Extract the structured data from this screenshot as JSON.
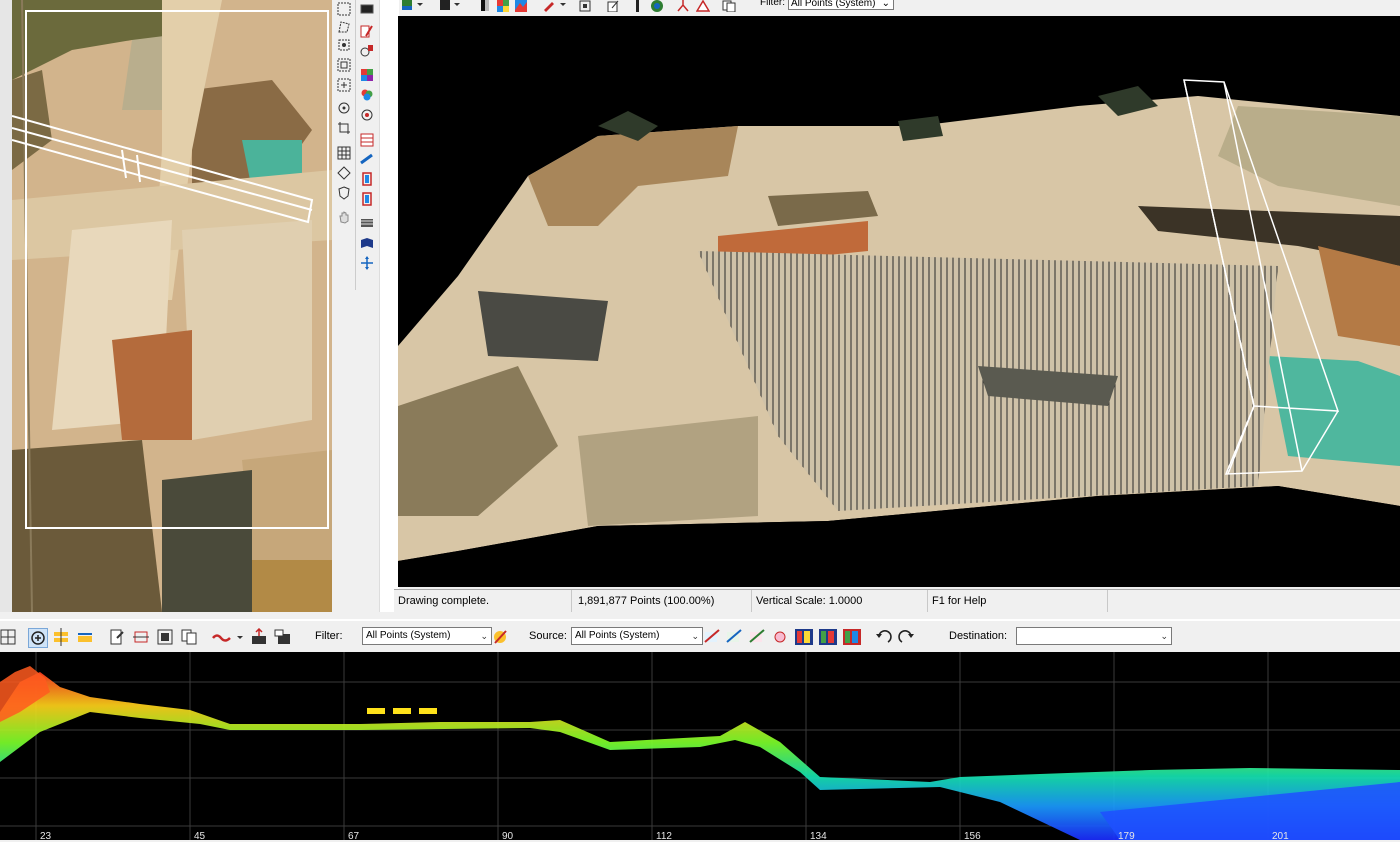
{
  "top_toolbar": {
    "filter_label": "Filter:",
    "filter_value": "All Points (System)"
  },
  "status": {
    "message": "Drawing complete.",
    "points": "1,891,877 Points (100.00%)",
    "vertical_scale": "Vertical Scale: 1.0000",
    "help": "F1 for Help"
  },
  "profile_toolbar": {
    "filter_label": "Filter:",
    "filter_value": "All Points (System)",
    "source_label": "Source:",
    "source_value": "All Points (System)",
    "destination_label": "Destination:",
    "destination_value": ""
  },
  "profile_axis": {
    "ticks": [
      "23",
      "45",
      "67",
      "90",
      "112",
      "134",
      "156",
      "179",
      "201"
    ]
  },
  "colors": {
    "toolbar_bg": "#f0f0f0",
    "view_bg": "#000000",
    "selection_box": "#ffffff"
  }
}
